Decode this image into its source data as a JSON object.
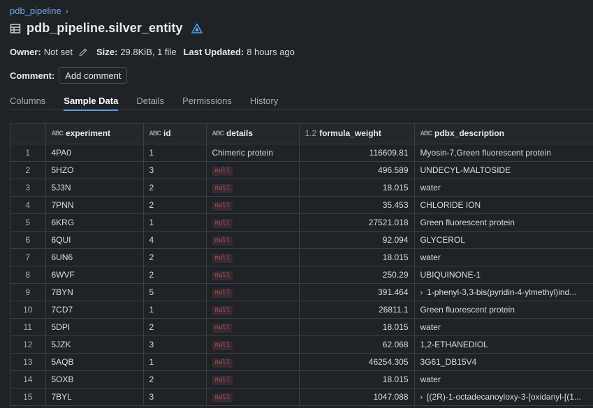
{
  "breadcrumb": {
    "parent": "pdb_pipeline",
    "chevron": "›"
  },
  "title": "pdb_pipeline.silver_entity",
  "meta": {
    "owner_label": "Owner:",
    "owner_value": "Not set",
    "size_label": "Size:",
    "size_value": "29.8KiB, 1 file",
    "updated_label": "Last Updated:",
    "updated_value": "8 hours ago"
  },
  "comment": {
    "label": "Comment:",
    "button": "Add comment"
  },
  "tabs": [
    {
      "label": "Columns",
      "active": false
    },
    {
      "label": "Sample Data",
      "active": true
    },
    {
      "label": "Details",
      "active": false
    },
    {
      "label": "Permissions",
      "active": false
    },
    {
      "label": "History",
      "active": false
    }
  ],
  "table": {
    "columns": [
      {
        "name": "",
        "type_icon": ""
      },
      {
        "name": "experiment",
        "type_icon": "ABC"
      },
      {
        "name": "id",
        "type_icon": "ABC"
      },
      {
        "name": "details",
        "type_icon": "ABC"
      },
      {
        "name": "formula_weight",
        "type_icon": "1.2"
      },
      {
        "name": "pdbx_description",
        "type_icon": "ABC"
      }
    ],
    "null_label": "null",
    "rows": [
      {
        "idx": "1",
        "experiment": "4PA0",
        "id": "1",
        "details": "Chimeric protein",
        "formula_weight": "116609.81",
        "pdbx_description": "Myosin-7,Green fluorescent protein",
        "expandable": false
      },
      {
        "idx": "2",
        "experiment": "5HZO",
        "id": "3",
        "details": null,
        "formula_weight": "496.589",
        "pdbx_description": "UNDECYL-MALTOSIDE",
        "expandable": false
      },
      {
        "idx": "3",
        "experiment": "5J3N",
        "id": "2",
        "details": null,
        "formula_weight": "18.015",
        "pdbx_description": "water",
        "expandable": false
      },
      {
        "idx": "4",
        "experiment": "7PNN",
        "id": "2",
        "details": null,
        "formula_weight": "35.453",
        "pdbx_description": "CHLORIDE ION",
        "expandable": false
      },
      {
        "idx": "5",
        "experiment": "6KRG",
        "id": "1",
        "details": null,
        "formula_weight": "27521.018",
        "pdbx_description": "Green fluorescent protein",
        "expandable": false
      },
      {
        "idx": "6",
        "experiment": "6QUI",
        "id": "4",
        "details": null,
        "formula_weight": "92.094",
        "pdbx_description": "GLYCEROL",
        "expandable": false
      },
      {
        "idx": "7",
        "experiment": "6UN6",
        "id": "2",
        "details": null,
        "formula_weight": "18.015",
        "pdbx_description": "water",
        "expandable": false
      },
      {
        "idx": "8",
        "experiment": "6WVF",
        "id": "2",
        "details": null,
        "formula_weight": "250.29",
        "pdbx_description": "UBIQUINONE-1",
        "expandable": false
      },
      {
        "idx": "9",
        "experiment": "7BYN",
        "id": "5",
        "details": null,
        "formula_weight": "391.464",
        "pdbx_description": "1-phenyl-3,3-bis(pyridin-4-ylmethyl)ind...",
        "expandable": true
      },
      {
        "idx": "10",
        "experiment": "7CD7",
        "id": "1",
        "details": null,
        "formula_weight": "26811.1",
        "pdbx_description": "Green fluorescent protein",
        "expandable": false
      },
      {
        "idx": "11",
        "experiment": "5DPI",
        "id": "2",
        "details": null,
        "formula_weight": "18.015",
        "pdbx_description": "water",
        "expandable": false
      },
      {
        "idx": "12",
        "experiment": "5JZK",
        "id": "3",
        "details": null,
        "formula_weight": "62.068",
        "pdbx_description": "1,2-ETHANEDIOL",
        "expandable": false
      },
      {
        "idx": "13",
        "experiment": "5AQB",
        "id": "1",
        "details": null,
        "formula_weight": "46254.305",
        "pdbx_description": "3G61_DB15V4",
        "expandable": false
      },
      {
        "idx": "14",
        "experiment": "5OXB",
        "id": "2",
        "details": null,
        "formula_weight": "18.015",
        "pdbx_description": "water",
        "expandable": false
      },
      {
        "idx": "15",
        "experiment": "7BYL",
        "id": "3",
        "details": null,
        "formula_weight": "1047.088",
        "pdbx_description": "[(2R)-1-octadecanoyloxy-3-[oxidanyl-[(1...",
        "expandable": true
      }
    ]
  }
}
